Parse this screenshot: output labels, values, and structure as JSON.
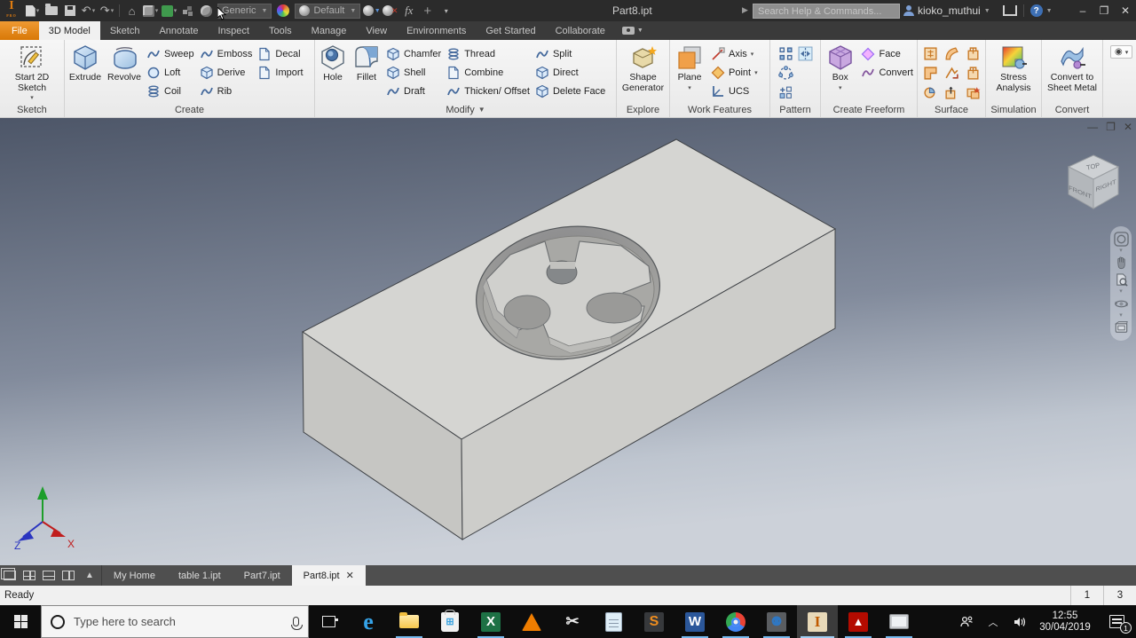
{
  "titlebar": {
    "logo_text": "I",
    "logo_sub": "PRO",
    "undo_glyph": "↶",
    "redo_glyph": "↷",
    "home_glyph": "⌂",
    "material_dropdown": "Generic",
    "appearance_dropdown": "Default",
    "fx_label": "fx",
    "plus_label": "+",
    "title": "Part8.ipt",
    "search_placeholder": "Search Help & Commands...",
    "user": "kioko_muthui",
    "help_glyph": "?",
    "minimize_glyph": "–",
    "restore_glyph": "❐",
    "close_glyph": "✕"
  },
  "ribbon": {
    "tabs": [
      {
        "label": "File"
      },
      {
        "label": "3D Model"
      },
      {
        "label": "Sketch"
      },
      {
        "label": "Annotate"
      },
      {
        "label": "Inspect"
      },
      {
        "label": "Tools"
      },
      {
        "label": "Manage"
      },
      {
        "label": "View"
      },
      {
        "label": "Environments"
      },
      {
        "label": "Get Started"
      },
      {
        "label": "Collaborate"
      }
    ],
    "panels": {
      "sketch": {
        "label": "Sketch",
        "start_2d": "Start 2D Sketch"
      },
      "create": {
        "label": "Create",
        "extrude": "Extrude",
        "revolve": "Revolve",
        "items": [
          "Sweep",
          "Loft",
          "Coil",
          "Emboss",
          "Derive",
          "Rib",
          "Decal",
          "Import"
        ]
      },
      "modify": {
        "label": "Modify",
        "hole": "Hole",
        "fillet": "Fillet",
        "items": [
          "Chamfer",
          "Shell",
          "Draft",
          "Thread",
          "Combine",
          "Thicken/ Offset",
          "Split",
          "Direct",
          "Delete Face"
        ]
      },
      "explore": {
        "label": "Explore",
        "shape_generator": "Shape Generator"
      },
      "work_features": {
        "label": "Work Features",
        "plane": "Plane",
        "items": [
          "Axis",
          "Point",
          "UCS"
        ]
      },
      "pattern": {
        "label": "Pattern"
      },
      "create_freeform": {
        "label": "Create Freeform",
        "box": "Box",
        "items": [
          "Face",
          "Convert"
        ]
      },
      "surface": {
        "label": "Surface"
      },
      "simulation": {
        "label": "Simulation",
        "stress": "Stress Analysis"
      },
      "convert": {
        "label": "Convert",
        "sheet_metal": "Convert to Sheet Metal"
      }
    }
  },
  "viewport": {
    "viewcube": {
      "top": "TOP",
      "front": "FRONT",
      "right": "RIGHT"
    },
    "axes": {
      "x": "X",
      "z": "Z"
    }
  },
  "doc_tabs": {
    "items": [
      {
        "label": "My Home"
      },
      {
        "label": "table 1.ipt"
      },
      {
        "label": "Part7.ipt"
      },
      {
        "label": "Part8.ipt"
      }
    ],
    "close_glyph": "✕"
  },
  "statusbar": {
    "message": "Ready",
    "field1": "1",
    "field2": "3"
  },
  "taskbar": {
    "search_placeholder": "Type here to search",
    "time": "12:55",
    "date": "30/04/2019",
    "notification_count": "1",
    "edge_glyph": "e",
    "excel_glyph": "X",
    "snip_glyph": "✂",
    "sublime_glyph": "S",
    "word_glyph": "W",
    "adsk_glyph": "⚉",
    "inventor_glyph": "I",
    "acrobat_glyph": "▲",
    "chevron_up": "︿"
  },
  "colors": {
    "accent_orange": "#d87806",
    "ribbon_bg": "#f0f0f0",
    "titlebar_bg": "#2b2b2b",
    "viewport_top": "#4d5668",
    "viewport_bottom": "#ccd1d9",
    "taskbar_underline": "#76b9ed",
    "model_top_face": "#d5d5d2",
    "model_side_face": "#c3c3c0"
  }
}
